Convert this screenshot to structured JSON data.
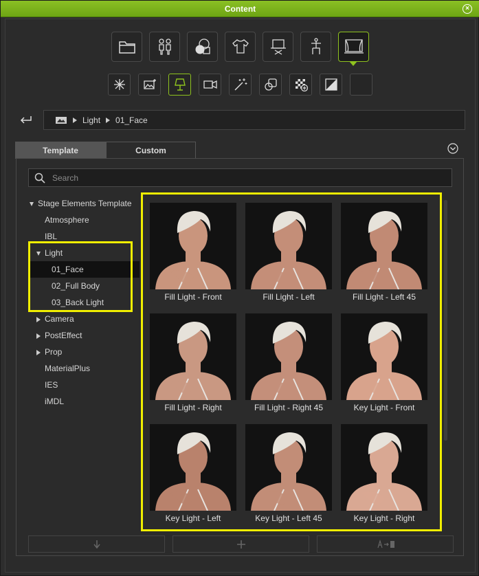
{
  "window": {
    "title": "Content",
    "close_label": "×"
  },
  "categories": [
    {
      "icon": "folder-icon"
    },
    {
      "icon": "actors-icon"
    },
    {
      "icon": "materials-icon"
    },
    {
      "icon": "clothing-icon"
    },
    {
      "icon": "props-icon"
    },
    {
      "icon": "animation-icon"
    },
    {
      "icon": "stage-icon",
      "active": true
    }
  ],
  "subcategories": [
    {
      "icon": "atmosphere-icon"
    },
    {
      "icon": "ibl-icon"
    },
    {
      "icon": "light-icon",
      "active": true
    },
    {
      "icon": "camera-icon"
    },
    {
      "icon": "posteffect-icon"
    },
    {
      "icon": "prop-icon"
    },
    {
      "icon": "materialplus-icon"
    },
    {
      "icon": "ies-icon"
    },
    {
      "icon": "empty-slot"
    }
  ],
  "breadcrumb": {
    "path": [
      "Light",
      "01_Face"
    ]
  },
  "tabs": {
    "template": "Template",
    "custom": "Custom"
  },
  "search": {
    "placeholder": "Search"
  },
  "tree": {
    "root": "Stage Elements Template",
    "items": [
      "Atmosphere",
      "IBL"
    ],
    "light": "Light",
    "light_children": [
      "01_Face",
      "02_Full Body",
      "03_Back Light"
    ],
    "rest": [
      "Camera",
      "PostEffect",
      "Prop"
    ],
    "leaves": [
      "MaterialPlus",
      "IES",
      "iMDL"
    ]
  },
  "thumbnails": [
    {
      "label": "Fill Light - Front"
    },
    {
      "label": "Fill Light - Left"
    },
    {
      "label": "Fill Light - Left 45"
    },
    {
      "label": "Fill Light - Right"
    },
    {
      "label": "Fill Light - Right 45"
    },
    {
      "label": "Key Light - Front"
    },
    {
      "label": "Key Light - Left"
    },
    {
      "label": "Key Light - Left 45"
    },
    {
      "label": "Key Light - Right"
    }
  ],
  "colors": {
    "accent": "#8fc31f",
    "highlight": "#f0ee00"
  }
}
